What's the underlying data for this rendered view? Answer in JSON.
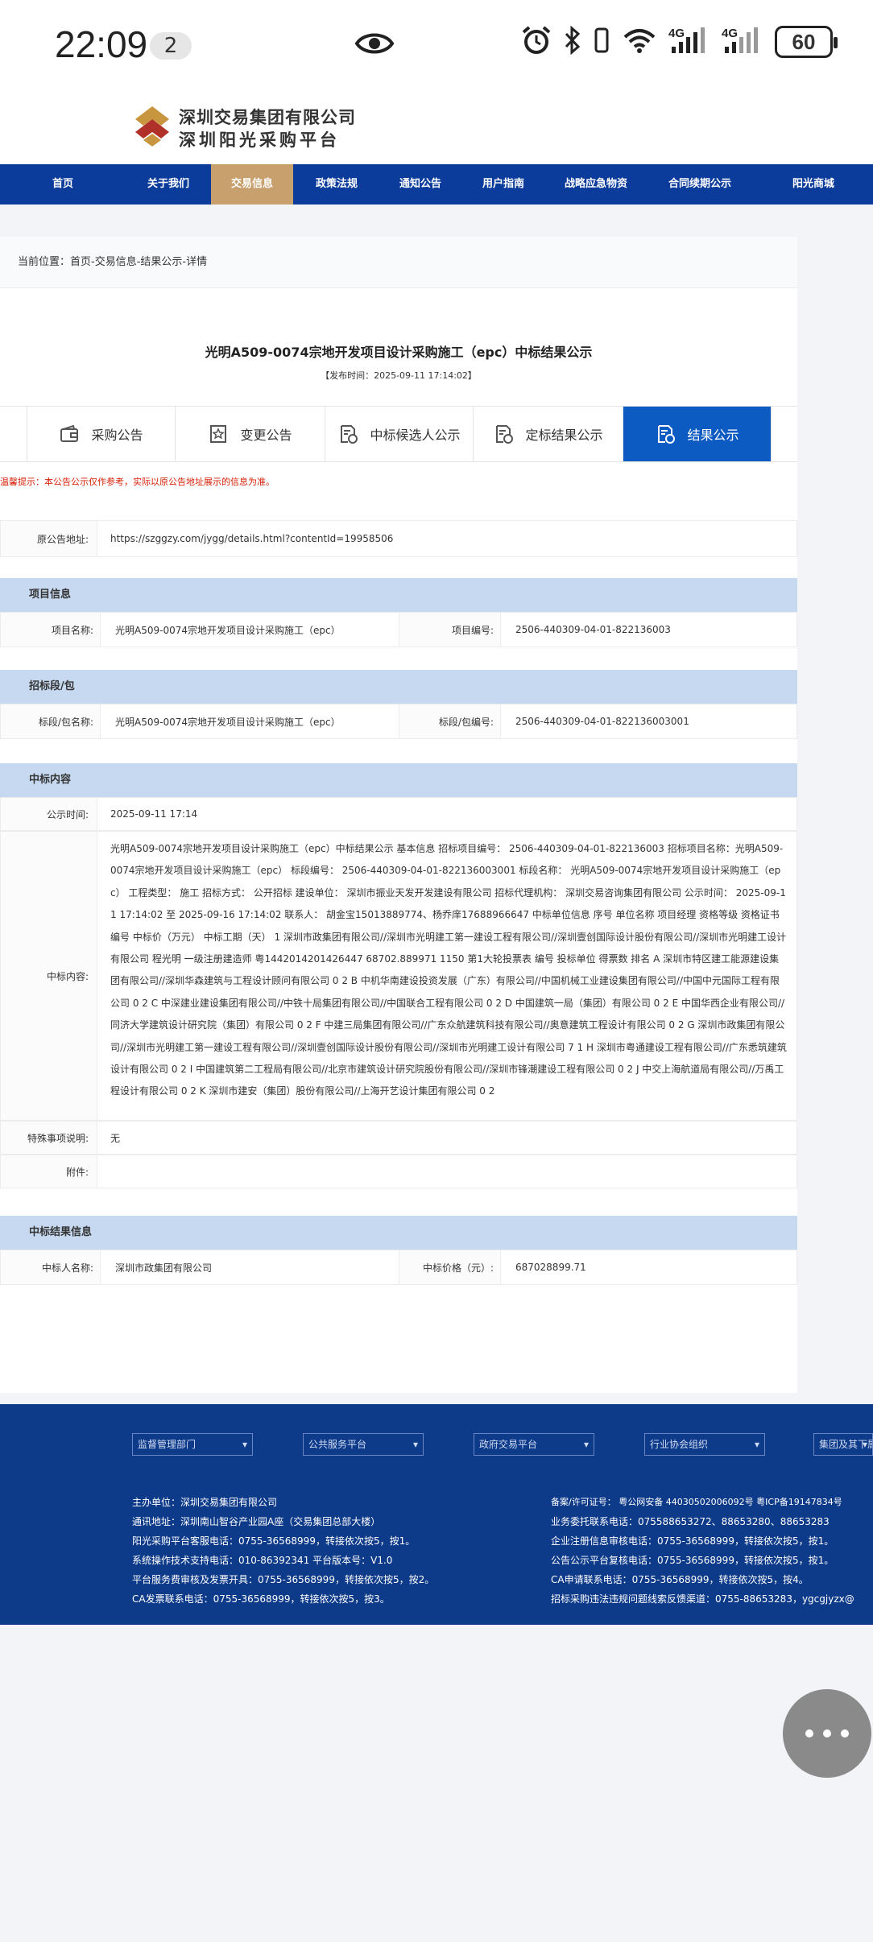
{
  "status_bar": {
    "time": "22:09",
    "notification_count": "2",
    "battery": "60",
    "network1": "4G",
    "network2": "4G",
    "wifi_label": "6"
  },
  "header": {
    "company_name": "深圳交易集团有限公司",
    "platform_name": "深圳阳光采购平台"
  },
  "nav": {
    "items": [
      "首页",
      "关于我们",
      "交易信息",
      "政策法规",
      "通知公告",
      "用户指南",
      "战略应急物资",
      "合同续期公示",
      "阳光商城"
    ],
    "active": "交易信息"
  },
  "breadcrumb": "当前位置：首页-交易信息-结果公示-详情",
  "notice": {
    "title": "光明A509-0074宗地开发项目设计采购施工（epc）中标结果公示",
    "publish_time": "【发布时间：2025-09-11 17:14:02】"
  },
  "tabs": [
    "采购公告",
    "变更公告",
    "中标候选人公示",
    "定标结果公示",
    "结果公示"
  ],
  "active_tab": "结果公示",
  "warning": "温馨提示：本公告公示仅作参考，实际以原公告地址展示的信息为准。",
  "original_url": {
    "label": "原公告地址:",
    "value": "https://szggzy.com/jygg/details.html?contentId=19958506"
  },
  "project_info": {
    "section_title": "项目信息",
    "name_label": "项目名称:",
    "name": "光明A509-0074宗地开发项目设计采购施工（epc）",
    "code_label": "项目编号:",
    "code": "2506-440309-04-01-822136003"
  },
  "bid_section": {
    "section_title": "招标段/包",
    "name_label": "标段/包名称:",
    "name": "光明A509-0074宗地开发项目设计采购施工（epc）",
    "code_label": "标段/包编号:",
    "code": "2506-440309-04-01-822136003001"
  },
  "award_content": {
    "section_title": "中标内容",
    "time_label": "公示时间:",
    "time": "2025-09-11 17:14",
    "content_label": "中标内容:",
    "content": "光明A509-0074宗地开发项目设计采购施工（epc）中标结果公示 基本信息 招标项目编号： 2506-440309-04-01-822136003 招标项目名称：光明A509-0074宗地开发项目设计采购施工（epc） 标段编号： 2506-440309-04-01-822136003001 标段名称： 光明A509-0074宗地开发项目设计采购施工（epc） 工程类型： 施工 招标方式： 公开招标 建设单位： 深圳市振业天发开发建设有限公司 招标代理机构： 深圳交易咨询集团有限公司 公示时间： 2025-09-11 17:14:02 至 2025-09-16 17:14:02 联系人： 胡金宝15013889774、杨乔庠17688966647 中标单位信息 序号 单位名称 项目经理 资格等级 资格证书编号 中标价（万元） 中标工期（天） 1 深圳市政集团有限公司//深圳市光明建工第一建设工程有限公司//深圳壹创国际设计股份有限公司//深圳市光明建工设计有限公司 程光明 一级注册建造师 粤1442014201426447 68702.889971 1150 第1大轮投票表 编号 投标单位 得票数 排名 A 深圳市特区建工能源建设集团有限公司//深圳华森建筑与工程设计顾问有限公司 0 2 B 中机华南建设投资发展（广东）有限公司//中国机械工业建设集团有限公司//中国中元国际工程有限公司 0 2 C 中深建业建设集团有限公司//中铁十局集团有限公司//中国联合工程有限公司 0 2 D 中国建筑一局（集团）有限公司 0 2 E 中国华西企业有限公司//同济大学建筑设计研究院（集团）有限公司 0 2 F 中建三局集团有限公司//广东众航建筑科技有限公司//奥意建筑工程设计有限公司 0 2 G 深圳市政集团有限公司//深圳市光明建工第一建设工程有限公司//深圳壹创国际设计股份有限公司//深圳市光明建工设计有限公司 7 1 H 深圳市粤通建设工程有限公司//广东悉筑建筑设计有限公司 0 2 I 中国建筑第二工程局有限公司//北京市建筑设计研究院股份有限公司//深圳市锋潮建设工程有限公司 0 2 J 中交上海航道局有限公司//万禹工程设计有限公司 0 2 K 深圳市建安（集团）股份有限公司//上海开艺设计集团有限公司 0 2",
    "special_label": "特殊事项说明:",
    "special": "无",
    "attachment_label": "附件:",
    "attachment": ""
  },
  "award_result": {
    "section_title": "中标结果信息",
    "winner_label": "中标人名称:",
    "winner": "深圳市政集团有限公司",
    "price_label": "中标价格（元）:",
    "price": "687028899.71"
  },
  "footer": {
    "selects": [
      "监督管理部门",
      "公共服务平台",
      "政府交易平台",
      "行业协会组织",
      "集团及其下属"
    ],
    "left_lines": [
      "主办单位：深圳交易集团有限公司",
      "通讯地址：深圳南山智谷产业园A座（交易集团总部大楼）",
      "阳光采购平台客服电话：0755-36568999，转接依次按5，按1。",
      "系统操作技术支持电话：010-86392341 平台版本号：V1.0",
      "平台服务费审核及发票开具：0755-36568999，转接依次按5，按2。",
      "CA发票联系电话：0755-36568999，转接依次按5，按3。"
    ],
    "right_lines": [
      "备案/许可证号： 粤公网安备 44030502006092号 粤ICP备19147834号",
      "业务委托联系电话：075588653272、88653280、88653283",
      "企业注册信息审核电话：0755-36568999，转接依次按5，按1。",
      "公告公示平台复核电话：0755-36568999，转接依次按5，按1。",
      "CA申请联系电话：0755-36568999，转接依次按5，按4。",
      "招标采购违法违规问题线索反馈渠道：0755-88653283，ygcgjyzx@"
    ]
  },
  "colors": {
    "nav_bg": "#0b3c9c",
    "nav_active": "#c8a06d",
    "tab_active": "#0b5bc2",
    "section_bg": "#c6d9f1",
    "footer_bg": "#0e3a8a",
    "warning": "#d81e06"
  }
}
